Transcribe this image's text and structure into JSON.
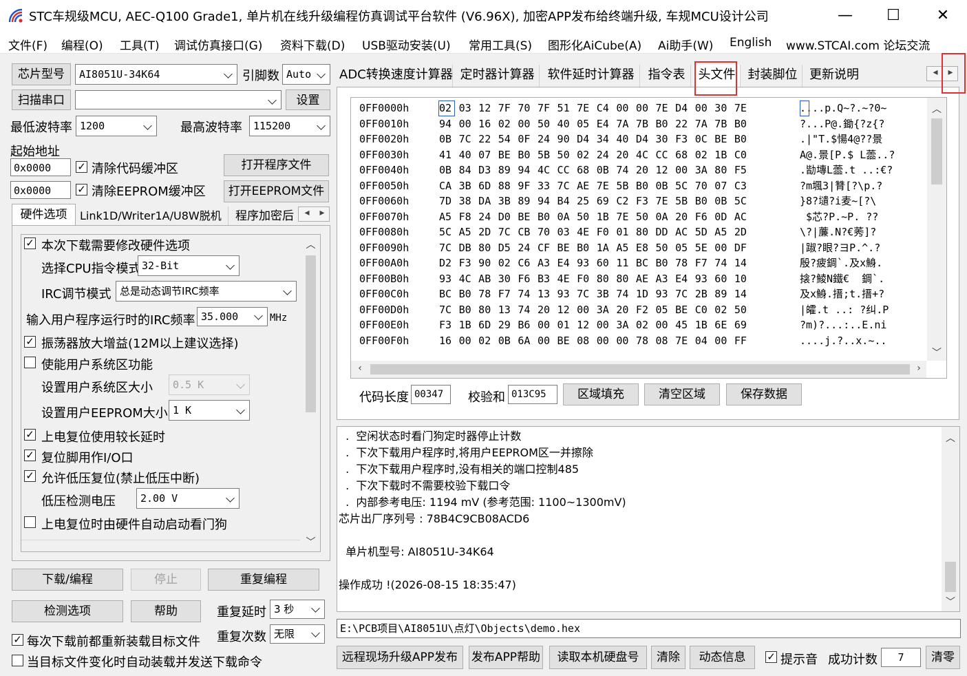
{
  "window": {
    "title": "STC车规级MCU, AEC-Q100 Grade1, 单片机在线升级编程仿真调试平台软件 (V6.96X), 加密APP发布给终端升级, 车规MCU设计公司",
    "minimize_glyph": "—",
    "maximize_glyph": "☐",
    "close_glyph": "✕"
  },
  "menu": [
    "文件(F)",
    "编程(O)",
    "工具(T)",
    "调试仿真接口(G)",
    "资料下载(D)",
    "USB驱动安装(U)",
    "常用工具(S)",
    "图形化AiCube(A)",
    "Ai助手(W)",
    "English",
    "www.STCAI.com 论坛交流"
  ],
  "left": {
    "chip_model_button": "芯片型号",
    "chip_model_value": "AI8051U-34K64",
    "pin_count_label": "引脚数",
    "pin_count_value": "Auto",
    "scan_port_button": "扫描串口",
    "port_value": "",
    "settings_button": "设置",
    "min_baud_label": "最低波特率",
    "min_baud_value": "1200",
    "max_baud_label": "最高波特率",
    "max_baud_value": "115200",
    "start_addr_label": "起始地址",
    "code_addr_value": "0x0000",
    "clear_code_label": "清除代码缓冲区",
    "open_program_button": "打开程序文件",
    "eeprom_addr_value": "0x0000",
    "clear_eeprom_label": "清除EEPROM缓冲区",
    "open_eeprom_button": "打开EEPROM文件",
    "tabs": [
      "硬件选项",
      "Link1D/Writer1A/U8W脱机",
      "程序加密后"
    ],
    "hw": {
      "modify_hw_label": "本次下载需要修改硬件选项",
      "cpu_mode_label": "选择CPU指令模式",
      "cpu_mode_value": "32-Bit",
      "irc_mode_label": "IRC调节模式",
      "irc_mode_value": "总是动态调节IRC频率",
      "irc_freq_label": "输入用户程序运行时的IRC频率",
      "irc_freq_value": "35.000",
      "irc_freq_unit": "MHz",
      "osc_gain_label": "振荡器放大增益(12M以上建议选择)",
      "user_sys_label": "使能用户系统区功能",
      "user_sys_size_label": "设置用户系统区大小",
      "user_sys_size_value": "0.5 K",
      "user_eeprom_size_label": "设置用户EEPROM大小",
      "user_eeprom_size_value": "1   K",
      "long_delay_label": "上电复位使用较长延时",
      "reset_io_label": "复位脚用作I/O口",
      "low_volt_reset_label": "允许低压复位(禁止低压中断)",
      "low_volt_detect_label": "低压检测电压",
      "low_volt_detect_value": "2.00 V",
      "watchdog_label": "上电复位时由硬件自动启动看门狗"
    },
    "download_button": "下载/编程",
    "stop_button": "停止",
    "reprogram_button": "重复编程",
    "check_options_button": "检测选项",
    "help_button": "帮助",
    "repeat_delay_label": "重复延时",
    "repeat_delay_value": "3 秒",
    "repeat_count_label": "重复次数",
    "repeat_count_value": "无限",
    "reload_label": "每次下载前都重新装载目标文件",
    "auto_send_label": "当目标文件变化时自动装载并发送下载命令"
  },
  "right": {
    "tabs": [
      "ADC转换速度计算器",
      "定时器计算器",
      "软件延时计算器",
      "指令表",
      "头文件",
      "封装脚位",
      "更新说明"
    ],
    "hex_rows": [
      {
        "addr": "0FF0000h",
        "bytes": "02 03 12 7F 70 7F 51 7E C4 00 00 7E D4 00 30 7E",
        "ascii": "....p.Q~?.~?0~"
      },
      {
        "addr": "0FF0010h",
        "bytes": "94 00 16 02 00 50 40 05 E4 7A 7B B0 22 7A 7B B0",
        "ascii": "?...P@.鋤{?z{?"
      },
      {
        "addr": "0FF0020h",
        "bytes": "0B 7C 22 54 0F 24 90 D4 34 40 D4 30 F3 0C BE B0",
        "ascii": ".|\"T.$愓4@??景"
      },
      {
        "addr": "0FF0030h",
        "bytes": "41 40 07 BE B0 5B 50 02 24 20 4C CC 68 02 1B C0",
        "ascii": "A@.景[P.$ L蘦..?"
      },
      {
        "addr": "0FF0040h",
        "bytes": "0B 84 D3 89 94 4C CC 68 0B 74 20 12 00 3A 80 F5",
        "ascii": ".勓塼L蘦.t ..:€?"
      },
      {
        "addr": "0FF0050h",
        "bytes": "CA 3B 6D 88 9F 33 7C AE 7E 5B B0 0B 5C 70 07 C3",
        "ascii": "?m堸3|甧[?\\p.?"
      },
      {
        "addr": "0FF0060h",
        "bytes": "7D 38 DA 3B 89 94 B4 25 69 C2 F3 7E 5B B0 0B 5C",
        "ascii": "}8?壝?i麦~[?\\"
      },
      {
        "addr": "0FF0070h",
        "bytes": "A5 F8 24 D0 BE B0 0A 50 1B 7E 50 0A 20 F6 0D AC",
        "ascii": " $芯?P.~P. ??"
      },
      {
        "addr": "0FF0080h",
        "bytes": "5C A5 2D 7C CB 70 03 4E F0 01 80 DD AC 5D A5 2D",
        "ascii": "\\?|薕.N?€莠]?"
      },
      {
        "addr": "0FF0090h",
        "bytes": "7C DB 80 D5 24 CF BE B0 1A A5 E8 50 05 5E 00 DF",
        "ascii": "|踧?眼?ヨP.^.?"
      },
      {
        "addr": "0FF00A0h",
        "bytes": "D2 F3 90 02 C6 A3 E4 93 60 11 BC B0 78 F7 74 14",
        "ascii": "殷?疲錭`.及x鯓."
      },
      {
        "addr": "0FF00B0h",
        "bytes": "93 4C AB 30 F6 B3 4E F0 80 80 AE A3 E4 93 60 10",
        "ascii": "搇?鯪N鐵€  錭`."
      },
      {
        "addr": "0FF00C0h",
        "bytes": "BC B0 78 F7 74 13 93 7C 3B 74 1D 93 7C 2B 89 14",
        "ascii": "及x鯓.搢;t.搢+?"
      },
      {
        "addr": "0FF00D0h",
        "bytes": "7C B0 80 13 74 20 12 00 3A 20 F2 05 BE C0 02 50",
        "ascii": "|皬.t ..: ?纠.P"
      },
      {
        "addr": "0FF00E0h",
        "bytes": "F3 1B 6D 29 B6 00 01 12 00 3A 02 00 45 1B 6E 69",
        "ascii": "?m)?...:..E.ni"
      },
      {
        "addr": "0FF00F0h",
        "bytes": "16 00 02 0B 6A 00 BE 08 00 00 78 08 7E 04 00 FF",
        "ascii": "....j.?..x.~.."
      }
    ],
    "code_length_label": "代码长度",
    "code_length_value": "00347",
    "checksum_label": "校验和",
    "checksum_value": "013C95",
    "fill_button": "区域填充",
    "clear_area_button": "清空区域",
    "save_data_button": "保存数据",
    "log_lines": [
      "  .  空闲状态时看门狗定时器停止计数",
      "  .  下次下载用户程序时,将用户EEPROM区一并擦除",
      "  .  下次下载用户程序时,没有相关的端口控制485",
      "  .  下次下载时不需要校验下载口令",
      "  .  内部参考电压: 1194 mV (参考范围: 1100~1300mV)",
      "芯片出厂序列号 : 78B4C9CB08ACD6",
      "",
      "  单片机型号: AI8051U-34K64",
      "",
      "操作成功 !(2026-08-15 18:35:47)"
    ],
    "file_path": "E:\\PCB项目\\AI8051U\\点灯\\Objects\\demo.hex",
    "remote_upgrade_button": "远程现场升级APP发布",
    "publish_help_button": "发布APP帮助",
    "read_disk_button": "读取本机硬盘号",
    "clear_button": "清除",
    "dynamic_info_button": "动态信息",
    "beep_label": "提示音",
    "success_count_label": "成功计数",
    "success_count_value": "7",
    "reset_count_button": "清零"
  }
}
